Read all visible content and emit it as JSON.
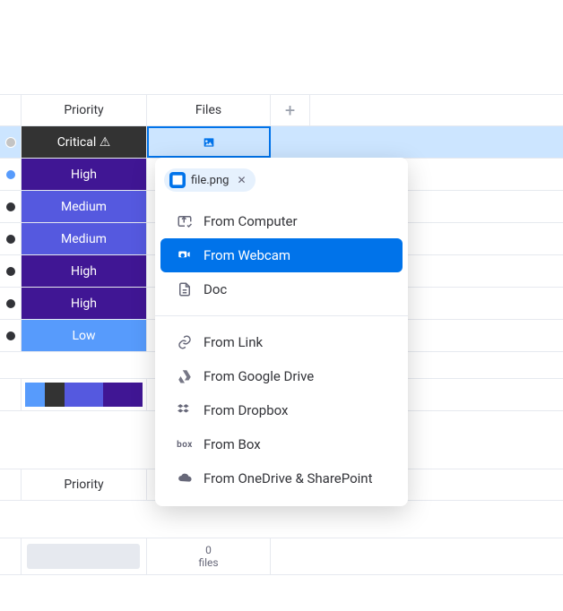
{
  "columns": {
    "priority": "Priority",
    "files": "Files"
  },
  "rows": [
    {
      "label": "Critical ⚠",
      "bg": "#333333",
      "dot": "dot-gray"
    },
    {
      "label": "High",
      "bg": "#401694",
      "dot": "dot-blue"
    },
    {
      "label": "Medium",
      "bg": "#5559df",
      "dot": "dot-dark"
    },
    {
      "label": "Medium",
      "bg": "#5559df",
      "dot": "dot-dark"
    },
    {
      "label": "High",
      "bg": "#401694",
      "dot": "dot-dark"
    },
    {
      "label": "High",
      "bg": "#401694",
      "dot": "dot-dark"
    },
    {
      "label": "Low",
      "bg": "#579bfc",
      "dot": "dot-dark"
    }
  ],
  "swatches": [
    "#579bfc",
    "#333333",
    "#5559df",
    "#5559df",
    "#401694",
    "#401694"
  ],
  "files_summary": {
    "count": "0",
    "label": "files"
  },
  "popover": {
    "chip": {
      "label": "file.png"
    },
    "items_top": [
      {
        "key": "computer",
        "label": "From Computer"
      },
      {
        "key": "webcam",
        "label": "From Webcam"
      },
      {
        "key": "doc",
        "label": "Doc"
      }
    ],
    "items_bottom": [
      {
        "key": "link",
        "label": "From Link"
      },
      {
        "key": "gdrive",
        "label": "From Google Drive"
      },
      {
        "key": "dropbox",
        "label": "From Dropbox"
      },
      {
        "key": "box",
        "label": "From Box"
      },
      {
        "key": "onedrive",
        "label": "From OneDrive & SharePoint"
      }
    ],
    "highlighted": "webcam"
  }
}
